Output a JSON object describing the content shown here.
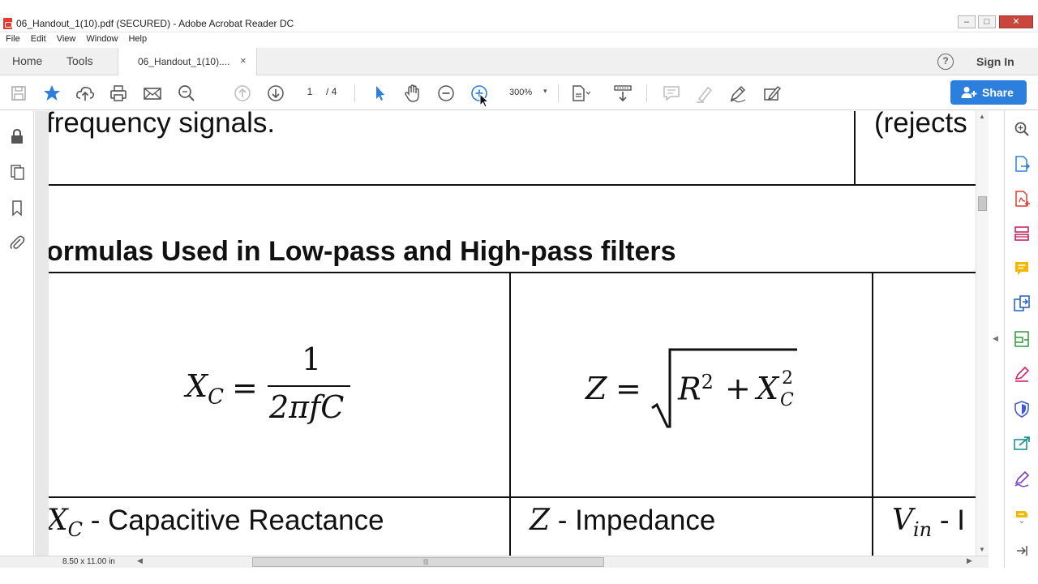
{
  "window": {
    "title": "06_Handout_1(10).pdf (SECURED) - Adobe Acrobat Reader DC",
    "minimize": "–",
    "maximize": "□",
    "close": "✕"
  },
  "menu": [
    "File",
    "Edit",
    "View",
    "Window",
    "Help"
  ],
  "tabs": {
    "home": "Home",
    "tools": "Tools",
    "document": "06_Handout_1(10)....",
    "close": "×",
    "help": "?",
    "sign_in": "Sign In"
  },
  "toolbar": {
    "page_current": "1",
    "page_total": "/ 4",
    "zoom": "300%",
    "zoom_caret": "▾",
    "share": "Share",
    "accent_color": "#2d7fde",
    "icons": [
      "save-icon",
      "bookmark-star-icon",
      "upload-cloud-icon",
      "print-icon",
      "email-icon",
      "search-zoom-icon",
      "page-up-icon",
      "page-down-icon",
      "select-arrow-icon",
      "hand-pan-icon",
      "zoom-out-icon",
      "zoom-in-icon",
      "page-fit-icon",
      "scroll-mode-icon",
      "comment-icon",
      "highlight-pen-icon",
      "sign-pen-icon",
      "fill-sign-icon"
    ]
  },
  "document": {
    "top_left": "frequency signals.",
    "top_right": "(rejects",
    "heading": "ormulas Used in Low-pass and High-pass filters",
    "formula1": {
      "lhs": "X",
      "lhs_sub": "C",
      "eq": "=",
      "numerator": "1",
      "denominator": "2πfC"
    },
    "formula2": {
      "lhs": "Z",
      "eq": "=",
      "r": "R",
      "r_sup": "2",
      "plus": "+",
      "x": "X",
      "x_sup": "2",
      "x_sub": "C"
    },
    "def1": {
      "sym": "X",
      "sub": "C",
      "text": " - Capacitive Reactance"
    },
    "def2": {
      "sym": "Z",
      "text": " - Impedance"
    },
    "def3": {
      "sym": "V",
      "sub": "in",
      "text": " - I"
    }
  },
  "status": {
    "page_size": "8.50 x 11.00 in"
  },
  "left_pane_icons": [
    "lock-icon",
    "pages-icon",
    "bookmark-icon",
    "attachment-icon"
  ],
  "right_pane_icons": [
    "search-zoom-icon",
    "export-pdf-icon",
    "create-pdf-icon",
    "organize-pages-icon",
    "comment-icon",
    "combine-files-icon",
    "compress-icon",
    "fill-sign-icon",
    "protect-shield-icon",
    "send-track-icon",
    "edit-pdf-icon",
    "stamp-icon",
    "expand-icon"
  ]
}
